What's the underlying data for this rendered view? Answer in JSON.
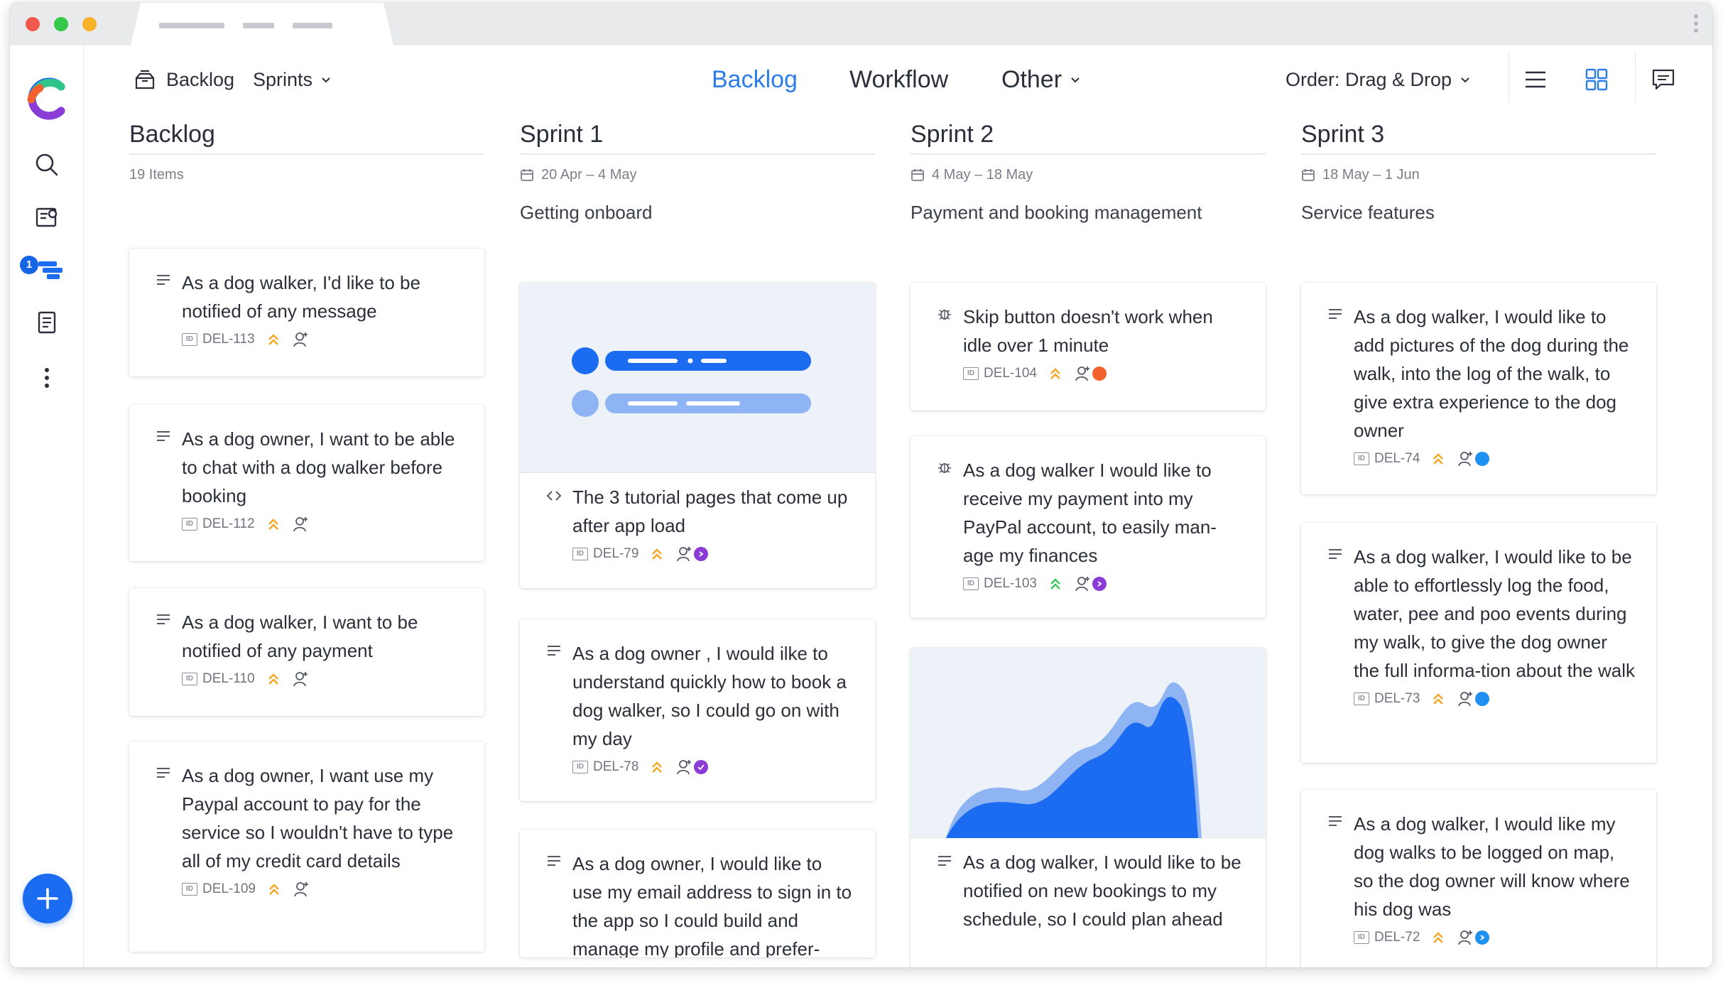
{
  "topbar": {
    "breadcrumb": "Backlog",
    "sprints_menu": "Sprints",
    "tabs": [
      {
        "label": "Backlog",
        "active": true
      },
      {
        "label": "Workflow",
        "active": false
      },
      {
        "label": "Other",
        "active": false
      }
    ],
    "order_label": "Order: Drag & Drop"
  },
  "sidebar": {
    "badge_count": "1"
  },
  "colors": {
    "accent": "#2b7de9",
    "priority_high": "#f5a623",
    "priority_low": "#34c759",
    "purple": "#8b3bd6",
    "orange": "#f1622e",
    "blue": "#1e90f0"
  },
  "columns": [
    {
      "title": "Backlog",
      "meta": "19 Items",
      "goal": "",
      "cards": [
        {
          "title": "As a dog walker, I'd like to be notified of any message",
          "key": "DEL-113"
        },
        {
          "title": "As a dog owner, I want to be able to chat with a dog walker before booking",
          "key": "DEL-112"
        },
        {
          "title": "As a dog walker, I want to be notified of any payment",
          "key": "DEL-110"
        },
        {
          "title": "As a dog owner, I want use my Paypal account to pay for the service so I wouldn't have to type all of my credit card details",
          "key": "DEL-109"
        }
      ]
    },
    {
      "title": "Sprint 1",
      "meta": "20 Apr – 4 May",
      "goal": "Getting onboard",
      "cards": [
        {
          "title": "The 3 tutorial pages that come up after app load",
          "key": "DEL-79"
        },
        {
          "title": "As a dog owner , I would ilke to understand quickly how to book a dog walker, so I could go on with my day",
          "key": "DEL-78"
        },
        {
          "title": "As a dog owner, I would like to use my email address to sign in to the app so I could build and manage my profile and prefer-",
          "key": ""
        }
      ]
    },
    {
      "title": "Sprint 2",
      "meta": "4 May – 18 May",
      "goal": "Payment and booking management",
      "cards": [
        {
          "title": "Skip button doesn't work when idle over 1 minute",
          "key": "DEL-104"
        },
        {
          "title": "As a dog walker I would like to receive my payment into my PayPal account, to easily man-age my finances",
          "key": "DEL-103"
        },
        {
          "title": "As a dog walker, I would like to be notified on new bookings to my schedule, so I could plan ahead",
          "key": ""
        }
      ]
    },
    {
      "title": "Sprint 3",
      "meta": "18 May – 1 Jun",
      "goal": "Service features",
      "cards": [
        {
          "title": "As a dog walker, I would like to add pictures of the dog during the walk, into the log of the walk, to give extra experience to the dog owner",
          "key": "DEL-74"
        },
        {
          "title": "As a dog walker, I would like to be able to effortlessly log the food, water, pee and poo events during my walk, to give the dog owner the full informa-tion about the walk",
          "key": "DEL-73"
        },
        {
          "title": "As a dog walker, I would like my dog walks to be logged on map, so the dog owner will know where his dog was",
          "key": "DEL-72"
        }
      ]
    }
  ]
}
